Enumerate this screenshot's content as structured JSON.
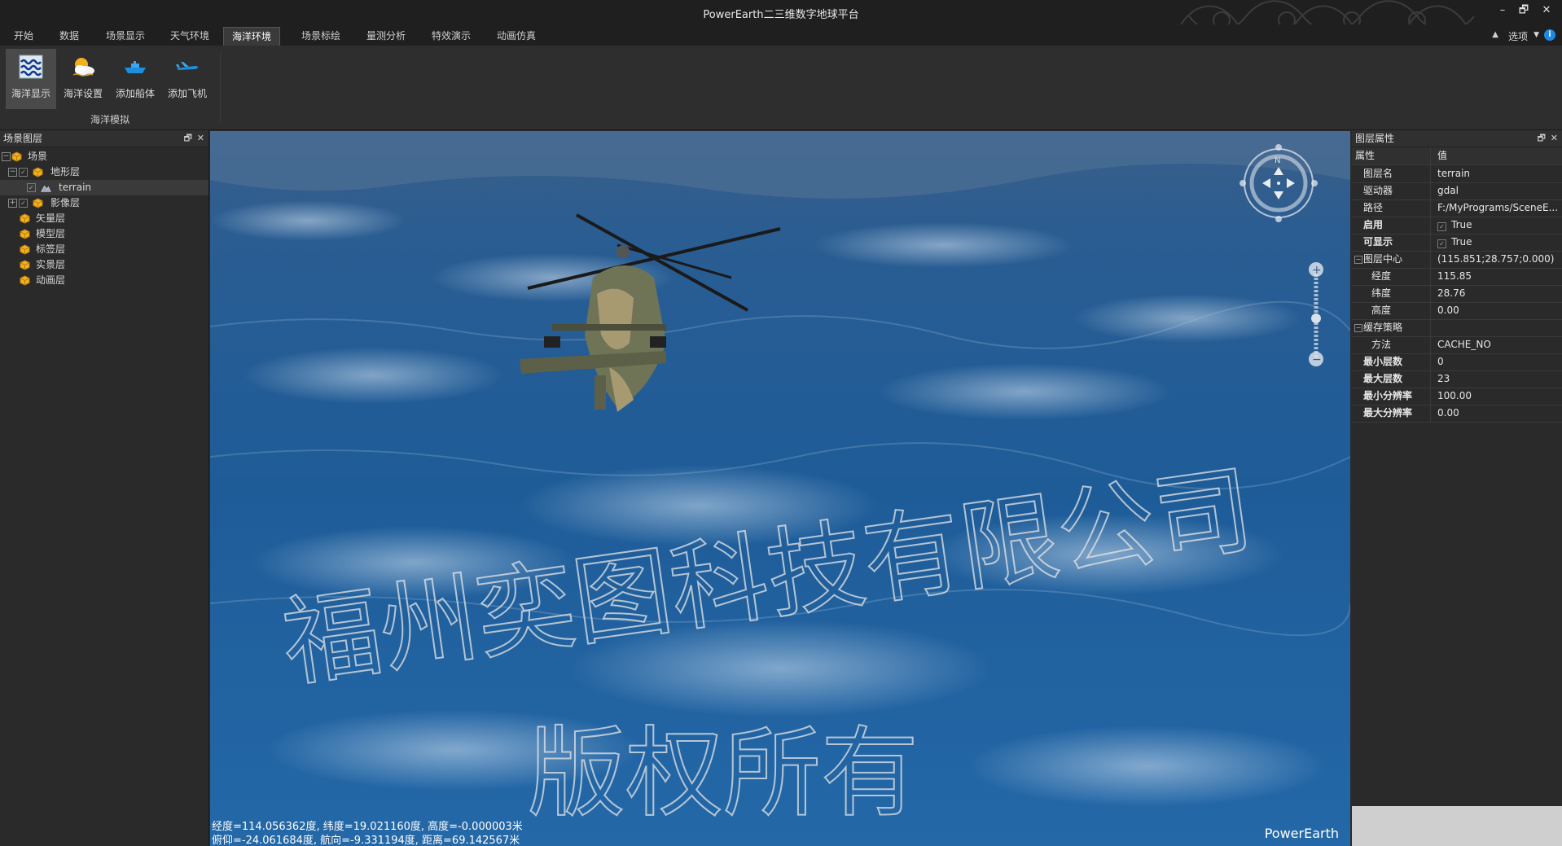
{
  "app": {
    "title": "PowerEarth二三维数字地球平台"
  },
  "window_controls": {
    "minimize": "–",
    "restore": "🗗",
    "close": "✕"
  },
  "menu": {
    "tabs": [
      {
        "label": "开始"
      },
      {
        "label": "数据"
      },
      {
        "label": "场景显示"
      },
      {
        "label": "天气环境"
      },
      {
        "label": "海洋环境",
        "active": true
      },
      {
        "label": "场景标绘"
      },
      {
        "label": "量测分析"
      },
      {
        "label": "特效演示"
      },
      {
        "label": "动画仿真"
      }
    ],
    "options_label": "选项",
    "help": "i"
  },
  "ribbon": {
    "buttons": [
      {
        "label": "海洋显示",
        "icon": "waves-icon",
        "selected": true
      },
      {
        "label": "海洋设置",
        "icon": "sun-cloud-icon"
      },
      {
        "label": "添加船体",
        "icon": "ship-icon"
      },
      {
        "label": "添加飞机",
        "icon": "airplane-icon"
      }
    ],
    "group_label": "海洋模拟"
  },
  "left_panel": {
    "title": "场景图层",
    "tree": [
      {
        "label": "场景",
        "level": 0,
        "expander": "−"
      },
      {
        "label": "地形层",
        "level": 1,
        "expander": "−",
        "checked": true
      },
      {
        "label": "terrain",
        "level": 2,
        "checked": true,
        "selected": true
      },
      {
        "label": "影像层",
        "level": 1,
        "expander": "+",
        "checked": true
      },
      {
        "label": "矢量层",
        "level": 1
      },
      {
        "label": "模型层",
        "level": 1
      },
      {
        "label": "标签层",
        "level": 1
      },
      {
        "label": "实景层",
        "level": 1
      },
      {
        "label": "动画层",
        "level": 1
      }
    ]
  },
  "viewport": {
    "watermark_line1": "福州奕图科技有限公司",
    "watermark_line2": "版权所有",
    "status_line1": "经度=114.056362度, 纬度=19.021160度, 高度=-0.000003米",
    "status_line2": "俯仰=-24.061684度, 航向=-9.331194度, 距离=69.142567米",
    "brand": "PowerEarth",
    "compass_north": "N",
    "zoom_in": "+",
    "zoom_out": "−"
  },
  "right_panel": {
    "title": "图层属性",
    "columns": {
      "key": "属性",
      "value": "值"
    },
    "rows": [
      {
        "key": "图层名",
        "value": "terrain"
      },
      {
        "key": "驱动器",
        "value": "gdal"
      },
      {
        "key": "路径",
        "value": "F:/MyPrograms/SceneE..."
      },
      {
        "key": "启用",
        "value": "True",
        "checkbox": true,
        "bold": true
      },
      {
        "key": "可显示",
        "value": "True",
        "checkbox": true,
        "bold": true
      },
      {
        "key": "图层中心",
        "value": "(115.851;28.757;0.000)",
        "group": true
      },
      {
        "key": "经度",
        "value": "115.85",
        "indent": true
      },
      {
        "key": "纬度",
        "value": "28.76",
        "indent": true
      },
      {
        "key": "高度",
        "value": "0.00",
        "indent": true
      },
      {
        "key": "缓存策略",
        "value": "",
        "group": true
      },
      {
        "key": "方法",
        "value": "CACHE_NO",
        "indent": true
      },
      {
        "key": "最小层数",
        "value": "0",
        "bold": true
      },
      {
        "key": "最大层数",
        "value": "23",
        "bold": true
      },
      {
        "key": "最小分辨率",
        "value": "100.00",
        "bold": true
      },
      {
        "key": "最大分辨率",
        "value": "0.00",
        "bold": true
      }
    ]
  },
  "colors": {
    "background": "#2b2b2b",
    "sea": "#1c4d7c",
    "accent": "#1e88e5"
  }
}
